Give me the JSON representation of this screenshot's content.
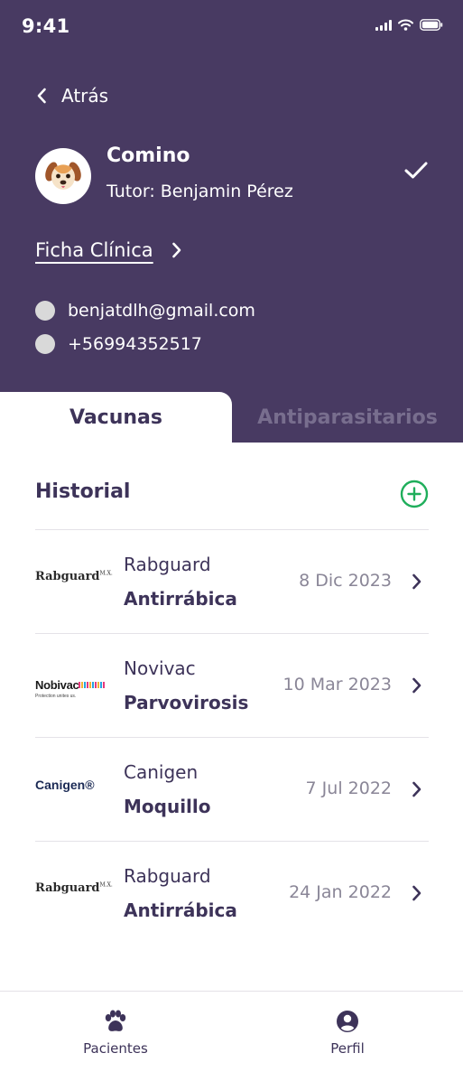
{
  "status_bar": {
    "time": "9:41"
  },
  "header": {
    "back_label": "Atrás",
    "pet_name": "Comino",
    "tutor": "Tutor: Benjamin Pérez",
    "clinical_record_label": "Ficha Clínica",
    "email": "benjatdlh@gmail.com",
    "phone": "+56994352517"
  },
  "tabs": [
    {
      "label": "Vacunas",
      "active": true
    },
    {
      "label": "Antiparasitarios",
      "active": false
    }
  ],
  "history": {
    "title": "Historial",
    "accent_color": "#1fae5b",
    "items": [
      {
        "logo": "Rabguard",
        "logo_mark": "M.X.",
        "brand": "Rabguard",
        "type": "Antirrábica",
        "date": "8 Dic 2023"
      },
      {
        "logo": "Nobivac",
        "logo_sub": "Protection unites us.",
        "brand": "Novivac",
        "type": "Parvovirosis",
        "date": "10 Mar 2023"
      },
      {
        "logo": "Canigen®",
        "brand": "Canigen",
        "type": "Moquillo",
        "date": "7 Jul 2022"
      },
      {
        "logo": "Rabguard",
        "logo_mark": "M.X.",
        "brand": "Rabguard",
        "type": "Antirrábica",
        "date": "24 Jan 2022"
      }
    ]
  },
  "bottom_nav": [
    {
      "label": "Pacientes",
      "icon": "paw-icon"
    },
    {
      "label": "Perfil",
      "icon": "profile-icon"
    }
  ],
  "colors": {
    "header_bg": "#483a62",
    "text_primary": "#3d3359",
    "text_muted": "#8a8697"
  }
}
